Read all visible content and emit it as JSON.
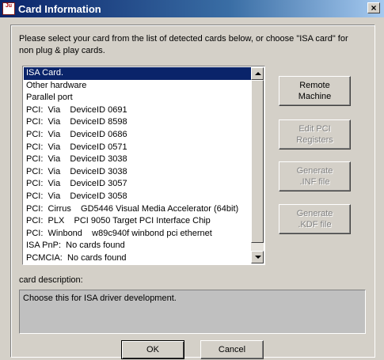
{
  "window": {
    "title": "Card Information",
    "icon_text": "Ju",
    "close_glyph": "×"
  },
  "instructions": "Please select your card from the list of detected cards below, or choose \"ISA card\" for non plug & play cards.",
  "card_list": {
    "selected_index": 0,
    "items": [
      "ISA Card.",
      "Other hardware",
      "Parallel port",
      "PCI:  Via    DeviceID 0691",
      "PCI:  Via    DeviceID 8598",
      "PCI:  Via    DeviceID 0686",
      "PCI:  Via    DeviceID 0571",
      "PCI:  Via    DeviceID 3038",
      "PCI:  Via    DeviceID 3038",
      "PCI:  Via    DeviceID 3057",
      "PCI:  Via    DeviceID 3058",
      "PCI:  Cirrus    GD5446 Visual Media Accelerator (64bit)",
      "PCI:  PLX    PCI 9050 Target PCI Interface Chip",
      "PCI:  Winbond    w89c940f winbond pci ethernet",
      "ISA PnP:  No cards found",
      "PCMCIA:  No cards found"
    ]
  },
  "side_buttons": {
    "remote_machine": "Remote\nMachine",
    "edit_pci_registers": "Edit PCI\nRegisters",
    "generate_inf": "Generate\n.INF file",
    "generate_kdf": "Generate\n.KDF file"
  },
  "description": {
    "label": "card description:",
    "text": "Choose this for ISA driver development."
  },
  "bottom_buttons": {
    "ok": "OK",
    "cancel": "Cancel"
  }
}
